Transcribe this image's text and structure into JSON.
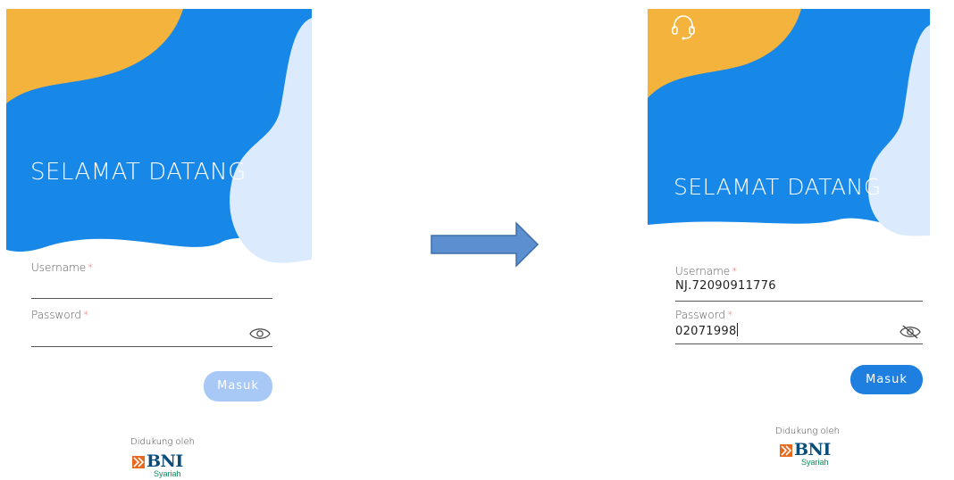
{
  "colors": {
    "blue": "#1787e8",
    "yellow": "#f3b33d",
    "light_blue": "#dbeafc",
    "button_disabled": "#a8c8f5",
    "button_active": "#1f7fe0",
    "required_mark": "#e05b5b",
    "arrow": "#5b8fcf"
  },
  "icons": {
    "headset": "headset-icon",
    "eye": "eye-icon",
    "eye_off": "eye-off-icon",
    "flow_arrow": "right-arrow-icon"
  },
  "left_screen": {
    "welcome": "SELAMAT DATANG",
    "username_label": "Username",
    "password_label": "Password",
    "required_mark": "*",
    "username_value": "",
    "password_value": "",
    "submit_label": "Masuk",
    "supported_by": "Didukung oleh",
    "logo_text": "BNI",
    "logo_sub": "Syariah"
  },
  "right_screen": {
    "welcome": "SELAMAT DATANG",
    "username_label": "Username",
    "password_label": "Password",
    "required_mark": "*",
    "username_value": "NJ.72090911776",
    "password_value": "02071998",
    "submit_label": "Masuk",
    "supported_by": "Didukung oleh",
    "logo_text": "BNI",
    "logo_sub": "Syariah"
  }
}
